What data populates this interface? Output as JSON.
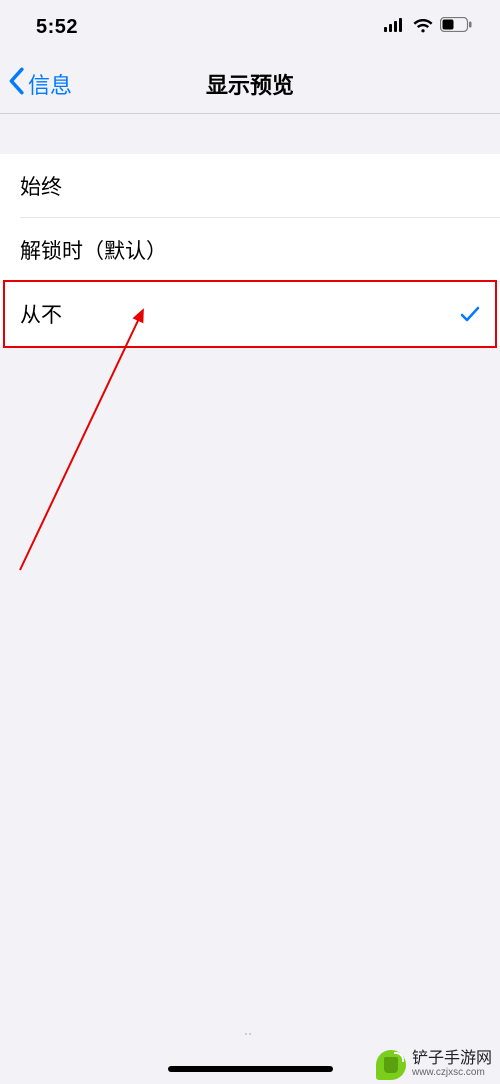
{
  "status": {
    "time": "5:52",
    "signal_icon": "cellular-signal-icon",
    "wifi_icon": "wifi-icon",
    "battery_icon": "battery-icon"
  },
  "nav": {
    "back_label": "信息",
    "title": "显示预览"
  },
  "options": [
    {
      "label": "始终",
      "selected": false
    },
    {
      "label": "解锁时（默认）",
      "selected": false
    },
    {
      "label": "从不",
      "selected": true
    }
  ],
  "annotation": {
    "highlight_index": 2,
    "arrow": true,
    "color": "#e60000"
  },
  "watermark": {
    "site_name": "铲子手游网",
    "url": "www.czjxsc.com"
  }
}
